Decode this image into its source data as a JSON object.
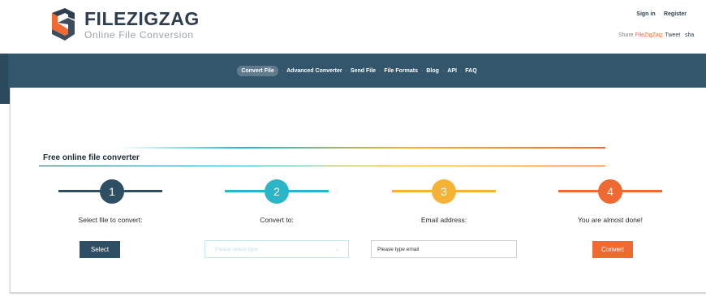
{
  "header": {
    "brand": "FILEZIGZAG",
    "tagline": "Online File Conversion",
    "sign_in": "Sign in",
    "auth_sep": "·",
    "register": "Register",
    "share_prefix": "Share",
    "share_brand": "FileZigZag:",
    "tweet": "Tweet",
    "share_more": "sha"
  },
  "nav": {
    "items": [
      {
        "label": "Convert File"
      },
      {
        "label": "Advanced Converter"
      },
      {
        "label": "Send File"
      },
      {
        "label": "File Formats"
      },
      {
        "label": "Blog"
      },
      {
        "label": "API"
      },
      {
        "label": "FAQ"
      }
    ],
    "separator": "·"
  },
  "main": {
    "title": "Free online file converter",
    "steps": [
      {
        "number": "1",
        "label": "Select file to convert:",
        "color": "#2e4e63"
      },
      {
        "number": "2",
        "label": "Convert to:",
        "color": "#2bb5c6"
      },
      {
        "number": "3",
        "label": "Email address:",
        "color": "#f3b436"
      },
      {
        "number": "4",
        "label": "You are almost done!",
        "color": "#ef6a32"
      }
    ],
    "select_button": "Select",
    "type_placeholder": "Please select type",
    "email_placeholder": "Please type email",
    "convert_button": "Convert"
  },
  "colors": {
    "navbar": "#33566d",
    "accent_orange": "#ef6a32",
    "accent_teal": "#2bb5c6",
    "accent_yellow": "#f3b436",
    "dark_blue": "#2e4e63"
  }
}
